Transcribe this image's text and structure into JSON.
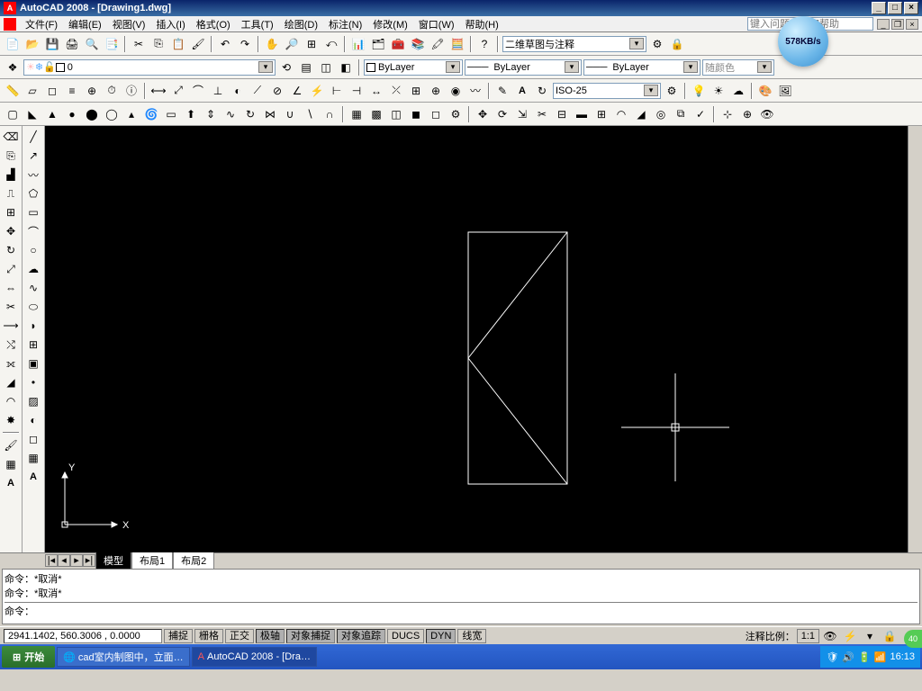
{
  "title": "AutoCAD 2008 - [Drawing1.dwg]",
  "speed_badge": "578KB/s",
  "menu": {
    "items": [
      "文件(F)",
      "编辑(E)",
      "视图(V)",
      "插入(I)",
      "格式(O)",
      "工具(T)",
      "绘图(D)",
      "标注(N)",
      "修改(M)",
      "窗口(W)",
      "帮助(H)"
    ],
    "help_placeholder": "键入问题以获取帮助"
  },
  "combos": {
    "workspace": "二维草图与注释",
    "layer": "0",
    "color": "ByLayer",
    "linetype": "ByLayer",
    "lineweight": "ByLayer",
    "plotstyle": "随颜色",
    "dimstyle": "ISO-25"
  },
  "tabs": {
    "model": "模型",
    "layout1": "布局1",
    "layout2": "布局2"
  },
  "cmd": {
    "line1": "命令：*取消*",
    "line2": "命令：*取消*",
    "prompt": "命令："
  },
  "status": {
    "coords": "2941.1402, 560.3006 , 0.0000",
    "buttons": [
      "捕捉",
      "栅格",
      "正交",
      "极轴",
      "对象捕捉",
      "对象追踪",
      "DUCS",
      "DYN",
      "线宽"
    ],
    "active": [
      false,
      false,
      false,
      true,
      true,
      true,
      false,
      true,
      false
    ],
    "annot_label": "注释比例：",
    "annot_scale": "1:1"
  },
  "taskbar": {
    "start": "开始",
    "items": [
      "cad室内制图中，立面…",
      "AutoCAD 2008 - [Dra…"
    ],
    "time": "16:13"
  },
  "ucs": {
    "x": "X",
    "y": "Y"
  },
  "corner": "40"
}
